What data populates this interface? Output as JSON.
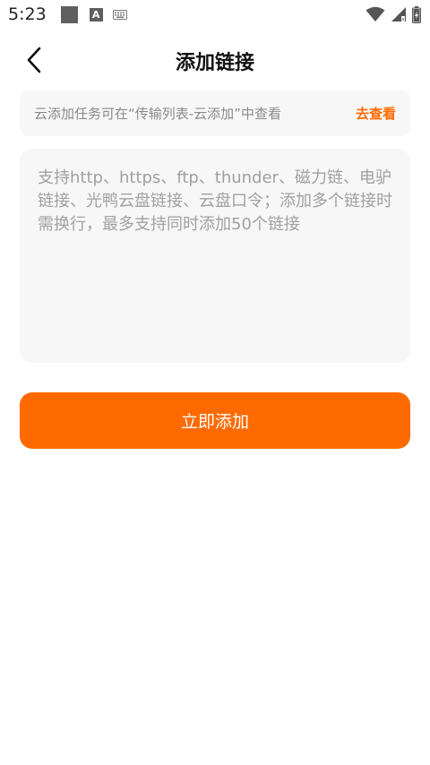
{
  "status_bar": {
    "time": "5:23",
    "icons": [
      "notification-square-icon",
      "a-badge-icon",
      "keyboard-icon",
      "wifi-icon",
      "signal-icon",
      "battery-icon"
    ],
    "a_badge": "A"
  },
  "header": {
    "title": "添加链接",
    "back_icon": "chevron-left-icon"
  },
  "tip": {
    "text": "云添加任务可在“传输列表-云添加”中查看",
    "link": "去查看"
  },
  "input": {
    "placeholder": "支持http、https、ftp、thunder、磁力链、电驴链接、光鸭云盘链接、云盘口令；添加多个链接时需换行，最多支持同时添加50个链接",
    "value": ""
  },
  "action": {
    "label": "立即添加"
  },
  "colors": {
    "accent": "#ff6a00",
    "panel_bg": "#f7f7f7",
    "placeholder": "#a0a0a0"
  }
}
